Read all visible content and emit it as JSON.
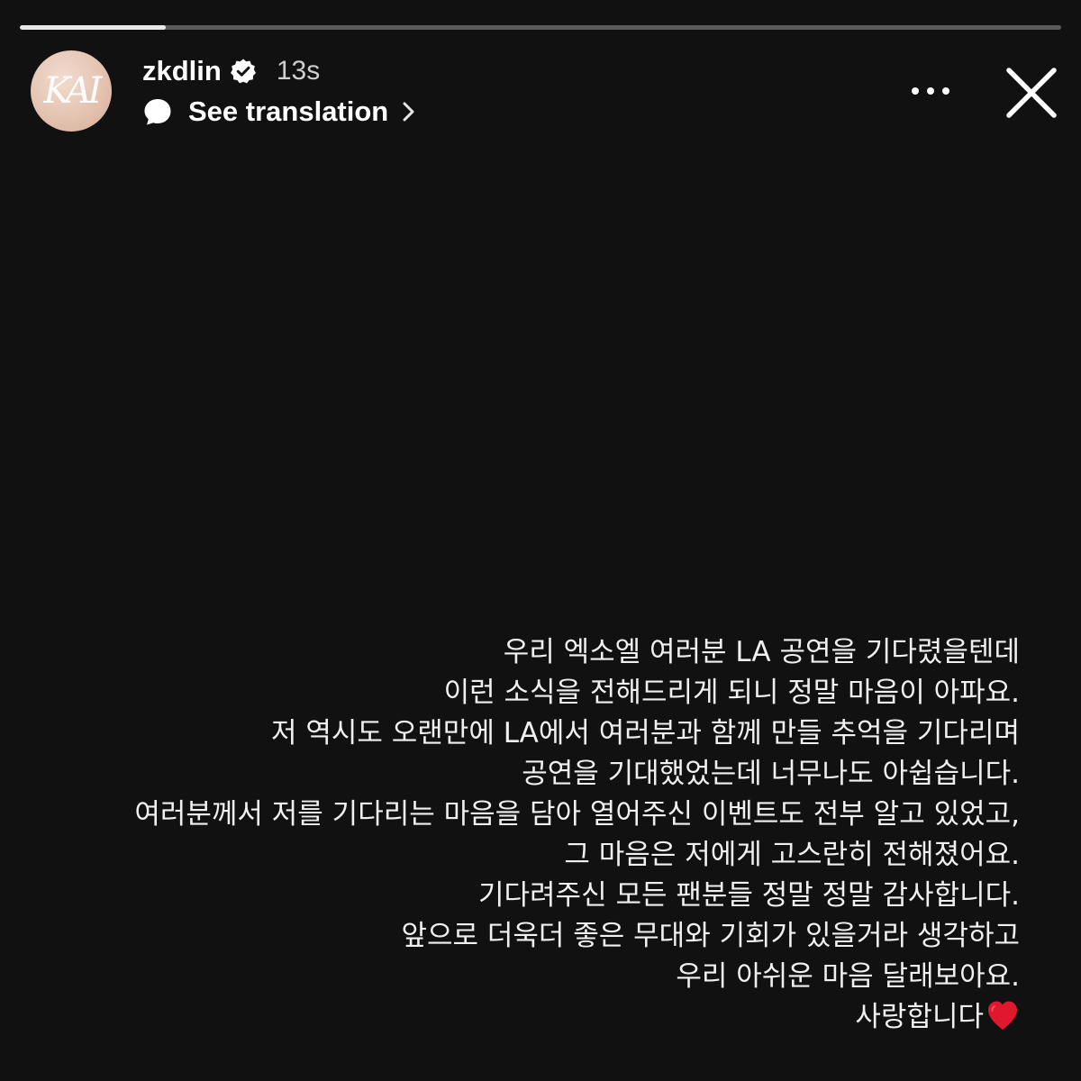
{
  "progress": {
    "fraction": 0.14
  },
  "header": {
    "avatar_monogram": "KAI",
    "username": "zkdlin",
    "verified_icon": "verified-badge-icon",
    "time": "13s",
    "translation_label": "See translation",
    "more_icon": "more-horizontal-icon",
    "close_icon": "close-icon"
  },
  "message": {
    "lines": [
      "우리 엑소엘 여러분 LA 공연을 기다렸을텐데",
      "이런 소식을 전해드리게 되니 정말 마음이 아파요.",
      "저 역시도 오랜만에 LA에서 여러분과 함께 만들 추억을 기다리며",
      "공연을 기대했었는데 너무나도 아쉽습니다.",
      "여러분께서 저를 기다리는 마음을 담아 열어주신 이벤트도 전부 알고 있었고,",
      "그 마음은 저에게 고스란히 전해졌어요.",
      "기다려주신 모든 팬분들 정말 정말 감사합니다.",
      "앞으로 더욱더 좋은 무대와 기회가 있을거라 생각하고",
      "우리 아쉬운 마음 달래보아요.",
      "사랑합니다"
    ],
    "heart_icon": "red-heart-icon"
  },
  "colors": {
    "background": "#111111",
    "text": "#f0f0f0",
    "heart": "#e0182d",
    "progress_fill": "#e8e8e8",
    "progress_track": "#5a5a5a"
  }
}
